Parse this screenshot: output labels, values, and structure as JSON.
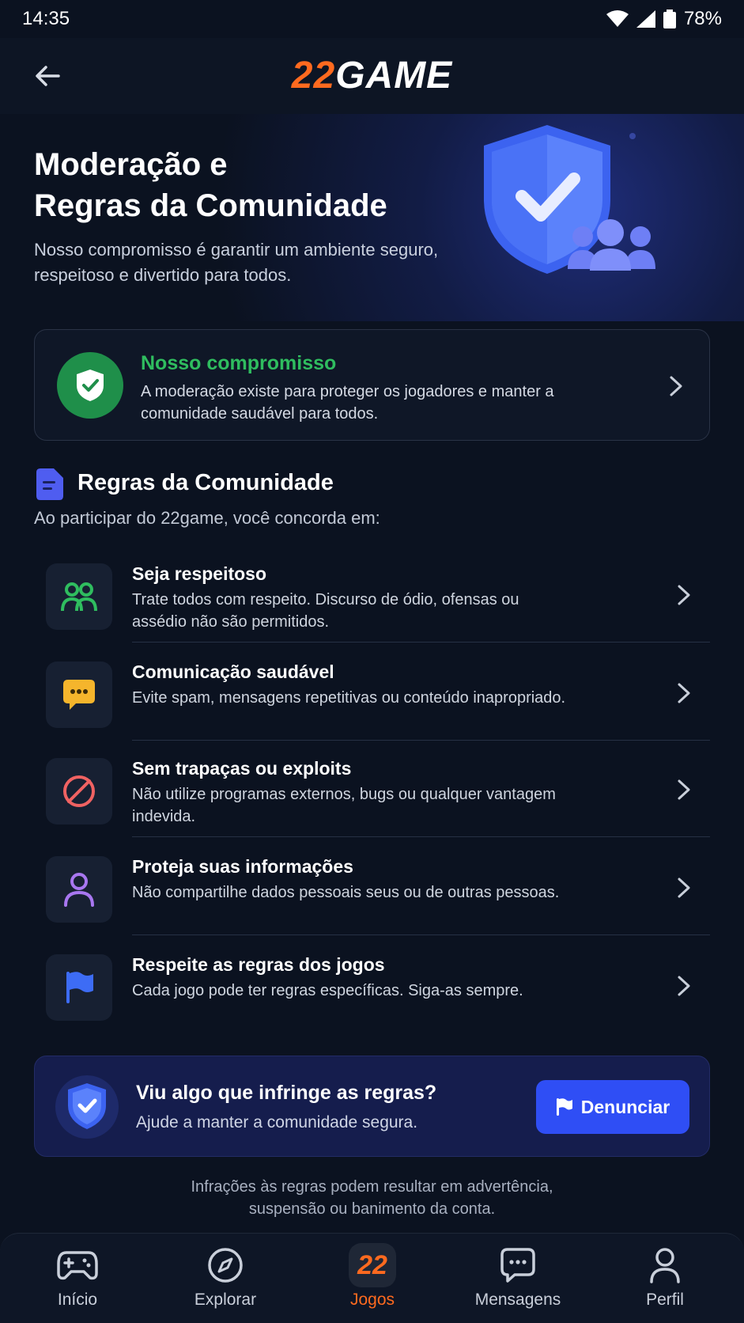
{
  "status_bar": {
    "time": "14:35",
    "battery": "78%"
  },
  "header": {
    "logo_number": "22",
    "logo_word": "GAME"
  },
  "hero": {
    "title_line1": "Moderação e",
    "title_line2": "Regras da Comunidade",
    "subtitle": "Nosso compromisso é garantir um ambiente seguro, respeitoso e divertido para todos."
  },
  "commitment": {
    "title": "Nosso compromisso",
    "text": "A moderação existe para proteger os jogadores e manter a comunidade saudável para todos."
  },
  "rules": {
    "title": "Regras da Comunidade",
    "subtitle": "Ao participar do 22game, você concorda em:",
    "items": [
      {
        "title": "Seja respeitoso",
        "desc": "Trate todos com respeito. Discurso de ódio, ofensas ou assédio não são permitidos.",
        "icon": "users-icon",
        "color": "#2fbd5f"
      },
      {
        "title": "Comunicação saudável",
        "desc": "Evite spam, mensagens repetitivas ou conteúdo inapropriado.",
        "icon": "chat-bubble-icon",
        "color": "#f5b52c"
      },
      {
        "title": "Sem trapaças ou exploits",
        "desc": "Não utilize programas externos, bugs ou qualquer vantagem indevida.",
        "icon": "prohibited-icon",
        "color": "#f06262"
      },
      {
        "title": "Proteja suas informações",
        "desc": "Não compartilhe dados pessoais seus ou de outras pessoas.",
        "icon": "user-icon",
        "color": "#a877f0"
      },
      {
        "title": "Respeite as regras dos jogos",
        "desc": "Cada jogo pode ter regras específicas. Siga-as sempre.",
        "icon": "flag-icon",
        "color": "#3d6cf5"
      }
    ]
  },
  "report": {
    "title": "Viu algo que infringe as regras?",
    "subtitle": "Ajude a manter a comunidade segura.",
    "button_label": "Denunciar"
  },
  "footer_note_line1": "Infrações às regras podem resultar em advertência,",
  "footer_note_line2": "suspensão ou banimento da conta.",
  "bottom_nav": {
    "items": [
      {
        "label": "Início",
        "icon": "gamepad-icon"
      },
      {
        "label": "Explorar",
        "icon": "compass-icon"
      },
      {
        "label": "Jogos",
        "icon": "22-logo-icon",
        "badge": "22",
        "active": true
      },
      {
        "label": "Mensagens",
        "icon": "messages-icon"
      },
      {
        "label": "Perfil",
        "icon": "profile-icon"
      }
    ]
  },
  "colors": {
    "accent_orange": "#ff6a1f",
    "accent_blue": "#2f4ef5",
    "success_green": "#2fbd5f",
    "background": "#0b1220"
  }
}
